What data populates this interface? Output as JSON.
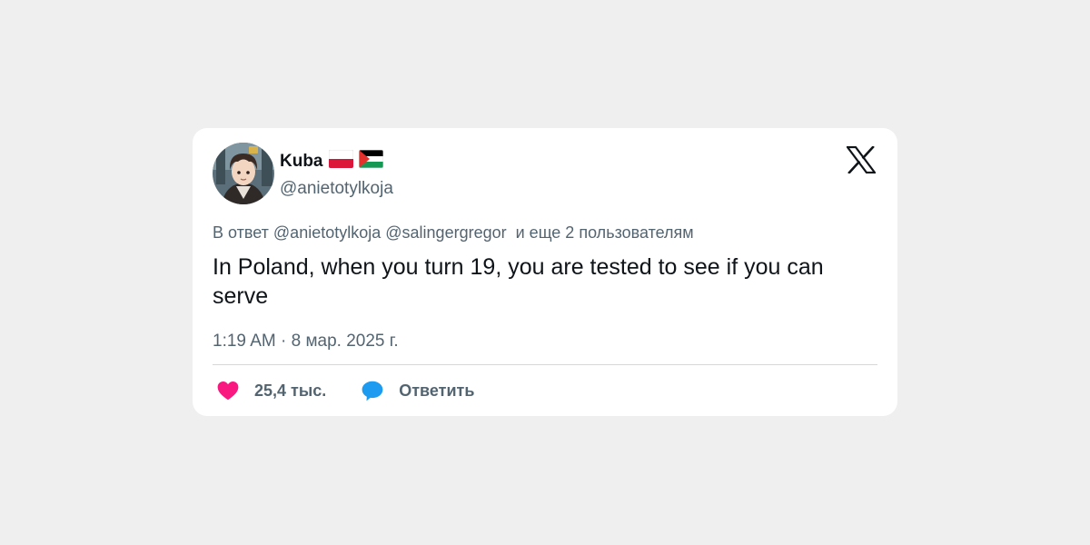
{
  "tweet": {
    "author": {
      "display_name": "Kuba",
      "flags": [
        "poland-flag-icon",
        "palestine-flag-icon"
      ],
      "handle": "@anietotylkoja"
    },
    "platform_logo": "x-logo-icon",
    "reply_context": {
      "prefix": "В ответ",
      "mentions": [
        "@anietotylkoja",
        "@salingergregor"
      ],
      "suffix": "и еще 2 пользователям"
    },
    "text": "In Poland, when you turn 19, you are tested to see if you can serve",
    "timestamp": "1:19 AM · 8 мар. 2025 г.",
    "actions": {
      "like": {
        "icon": "heart-icon",
        "label": "25,4 тыс.",
        "color": "#f91880"
      },
      "reply": {
        "icon": "speech-bubble-icon",
        "label": "Ответить",
        "color": "#1d9bf0"
      }
    }
  }
}
